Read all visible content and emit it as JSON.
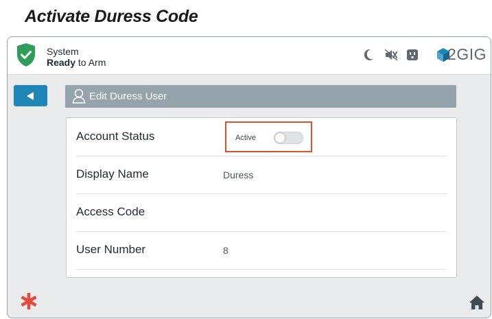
{
  "document": {
    "title": "Activate Duress Code"
  },
  "status": {
    "line1": "System",
    "line2_bold": "Ready",
    "line2_rest": " to Arm",
    "icons": [
      "moon-icon",
      "mute-icon",
      "outlet-icon"
    ],
    "logo": "2GIG",
    "shield_color": "#2f9e5a"
  },
  "nav": {
    "back_icon": "back-arrow-icon"
  },
  "header": {
    "title": "Edit Duress User",
    "icon": "user-icon"
  },
  "form": {
    "rows": [
      {
        "label": "Account Status",
        "value": "Active"
      },
      {
        "label": "Display Name",
        "value": "Duress"
      },
      {
        "label": "Access Code",
        "value": ""
      },
      {
        "label": "User Number",
        "value": "8"
      }
    ],
    "toggle_on": false
  },
  "footer": {
    "left_icon": "emergency-asterisk-icon",
    "right_icon": "home-icon"
  },
  "colors": {
    "accent_blue": "#1f87b8",
    "header_gray": "#95a3ad",
    "highlight_red": "#e0502a",
    "asterisk_red": "#e34a3a"
  }
}
